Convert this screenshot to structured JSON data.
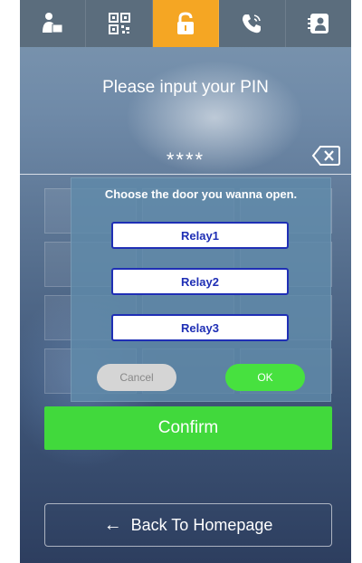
{
  "tabs": [
    {
      "icon": "person-with-package-icon",
      "active": false
    },
    {
      "icon": "qr-code-icon",
      "active": false
    },
    {
      "icon": "unlock-icon",
      "active": true
    },
    {
      "icon": "phone-call-icon",
      "active": false
    },
    {
      "icon": "contacts-icon",
      "active": false
    }
  ],
  "colors": {
    "active_tab": "#f5a623",
    "confirm": "#41d93c",
    "ok": "#47e13f",
    "relay_border": "#1f2fb5"
  },
  "prompt": "Please input your PIN",
  "pin_masked": "****",
  "dialog": {
    "title": "Choose the door you wanna open.",
    "relays": [
      "Relay1",
      "Relay2",
      "Relay3"
    ],
    "cancel_label": "Cancel",
    "ok_label": "OK"
  },
  "confirm_label": "Confirm",
  "back_label": "Back To Homepage",
  "back_arrow": "←"
}
